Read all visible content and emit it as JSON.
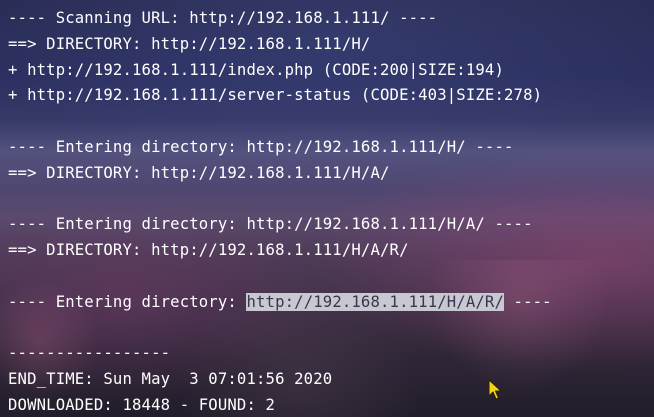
{
  "terminal": {
    "lines": [
      {
        "pre": "---- Scanning URL: http://192.168.1.111/ ----",
        "sel": "",
        "post": ""
      },
      {
        "pre": "==> DIRECTORY: http://192.168.1.111/H/",
        "sel": "",
        "post": ""
      },
      {
        "pre": "+ http://192.168.1.111/index.php (CODE:200|SIZE:194)",
        "sel": "",
        "post": ""
      },
      {
        "pre": "+ http://192.168.1.111/server-status (CODE:403|SIZE:278)",
        "sel": "",
        "post": ""
      },
      {
        "pre": "",
        "sel": "",
        "post": ""
      },
      {
        "pre": "---- Entering directory: http://192.168.1.111/H/ ----",
        "sel": "",
        "post": ""
      },
      {
        "pre": "==> DIRECTORY: http://192.168.1.111/H/A/",
        "sel": "",
        "post": ""
      },
      {
        "pre": "",
        "sel": "",
        "post": ""
      },
      {
        "pre": "---- Entering directory: http://192.168.1.111/H/A/ ----",
        "sel": "",
        "post": ""
      },
      {
        "pre": "==> DIRECTORY: http://192.168.1.111/H/A/R/",
        "sel": "",
        "post": ""
      },
      {
        "pre": "",
        "sel": "",
        "post": ""
      },
      {
        "pre": "---- Entering directory: ",
        "sel": "http://192.168.1.111/H/A/R/",
        "post": " ----"
      },
      {
        "pre": "",
        "sel": "",
        "post": ""
      },
      {
        "pre": "-----------------",
        "sel": "",
        "post": ""
      },
      {
        "pre": "END_TIME: Sun May  3 07:01:56 2020",
        "sel": "",
        "post": ""
      },
      {
        "pre": "DOWNLOADED: 18448 - FOUND: 2",
        "sel": "",
        "post": ""
      }
    ]
  },
  "colors": {
    "text": "#ffffff",
    "selection_bg": "#c8c8d0",
    "cursor": "#f3d21a"
  },
  "icons": {
    "cursor": "mouse-pointer-icon"
  }
}
